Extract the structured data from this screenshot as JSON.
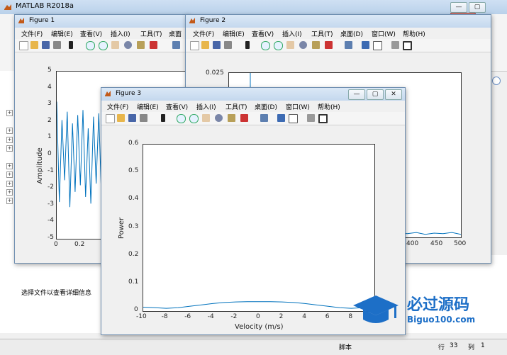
{
  "main_window": {
    "title": "MATLAB R2018a",
    "controls": [
      "—",
      "▢",
      "✕"
    ],
    "detail_text": "选择文件以查看详细信息",
    "status": {
      "script_label": "脚本",
      "row_label": "行",
      "row_value": "33",
      "col_label": "列",
      "col_value": "1"
    }
  },
  "menu_labels": [
    "文件(F)",
    "编辑(E)",
    "查看(V)",
    "插入(I)",
    "工具(T)",
    "桌面(D)",
    "窗口(W)",
    "帮助(H)"
  ],
  "figure1": {
    "title": "Figure 1",
    "menu_truncated": "桌面",
    "ylabel": "Amplitude",
    "ytick_labels": [
      "5",
      "4",
      "3",
      "2",
      "1",
      "0",
      "-1",
      "-2",
      "-3",
      "-4",
      "-5"
    ],
    "xtick_labels": [
      "0",
      "0.2"
    ]
  },
  "figure2": {
    "title": "Figure 2",
    "ytick_label": "0.025",
    "xtick_labels": [
      "400",
      "450",
      "500"
    ]
  },
  "figure3": {
    "title": "Figure 3",
    "xlabel": "Velocity (m/s)",
    "ylabel": "Power",
    "ytick_labels": [
      "0.6",
      "0.5",
      "0.4",
      "0.3",
      "0.2",
      "0.1",
      "0"
    ],
    "xtick_labels": [
      "-10",
      "-8",
      "-6",
      "-4",
      "-2",
      "0",
      "2",
      "4",
      "6",
      "8"
    ]
  },
  "chart_data": [
    {
      "type": "line",
      "figure": "Figure 1",
      "ylabel": "Amplitude",
      "ylim": [
        -5,
        5
      ],
      "x_visible": [
        0,
        0.27
      ],
      "x": [
        0,
        0.005,
        0.01,
        0.015,
        0.02,
        0.025,
        0.03,
        0.035,
        0.04,
        0.045,
        0.05,
        0.055,
        0.06,
        0.065,
        0.07,
        0.075,
        0.08,
        0.085,
        0.09,
        0.095,
        0.1,
        0.105,
        0.11,
        0.115,
        0.12,
        0.125,
        0.13,
        0.135,
        0.14,
        0.145,
        0.15,
        0.155,
        0.16,
        0.165,
        0.17,
        0.175,
        0.18,
        0.185,
        0.19,
        0.195,
        0.2,
        0.205,
        0.21,
        0.215,
        0.22,
        0.225,
        0.23,
        0.235,
        0.24,
        0.245,
        0.25,
        0.255,
        0.26,
        0.265
      ],
      "y": [
        3.2,
        -2.8,
        2.1,
        -1.5,
        2.6,
        -3.1,
        1.9,
        -2.2,
        2.4,
        -1.8,
        2.7,
        -2.5,
        1.6,
        -2.9,
        2.3,
        -1.7,
        2.5,
        -2.4,
        1.8,
        -2.1,
        2.2,
        -2.6,
        1.7,
        -1.9,
        2.4,
        -2.3,
        1.5,
        -2.0,
        2.1,
        -1.6,
        2.3,
        -2.2,
        1.4,
        -1.8,
        2.0,
        -2.1,
        1.6,
        -1.7,
        1.9,
        -1.5,
        2.1,
        -1.9,
        1.3,
        -1.6,
        1.8,
        -1.4,
        1.7,
        -1.8,
        1.5,
        -1.3,
        1.6,
        -1.5,
        1.2,
        -1.4
      ]
    },
    {
      "type": "line",
      "figure": "Figure 2",
      "ylim": [
        0,
        0.027
      ],
      "x_visible": [
        370,
        500
      ],
      "x": [
        370,
        375,
        380,
        385,
        390,
        395,
        400,
        405,
        410,
        415,
        420,
        425,
        430,
        435,
        440,
        445,
        450,
        455,
        460,
        465,
        470,
        475,
        480,
        485,
        490,
        495,
        500
      ],
      "y": [
        0.0006,
        0.0009,
        0.0005,
        0.0011,
        0.0007,
        0.0013,
        0.0006,
        0.001,
        0.0004,
        0.0008,
        0.0005,
        0.0009,
        0.0006,
        0.0007,
        0.0005,
        0.0008,
        0.0006,
        0.0009,
        0.0005,
        0.0007,
        0.0006,
        0.0008,
        0.0005,
        0.0007,
        0.0006,
        0.0008,
        0.0005
      ]
    },
    {
      "type": "line",
      "figure": "Figure 3",
      "xlabel": "Velocity (m/s)",
      "ylabel": "Power",
      "xlim": [
        -10,
        10
      ],
      "ylim": [
        0,
        0.6
      ],
      "x": [
        -10,
        -9,
        -8,
        -7,
        -6,
        -5,
        -4,
        -3,
        -2,
        -1,
        0,
        1,
        2,
        3,
        4,
        5,
        6,
        7,
        8,
        9,
        10
      ],
      "y": [
        0.014,
        0.012,
        0.01,
        0.012,
        0.017,
        0.022,
        0.027,
        0.031,
        0.033,
        0.034,
        0.034,
        0.034,
        0.033,
        0.031,
        0.027,
        0.022,
        0.017,
        0.012,
        0.01,
        0.012,
        0.014
      ]
    }
  ],
  "colors": {
    "line": "#0072bd",
    "title_bar": "#c4d8ee",
    "watermark": "#1d6fc7"
  },
  "watermark": {
    "cn_text": "必过源码",
    "url_text": "Biguo100.com"
  }
}
